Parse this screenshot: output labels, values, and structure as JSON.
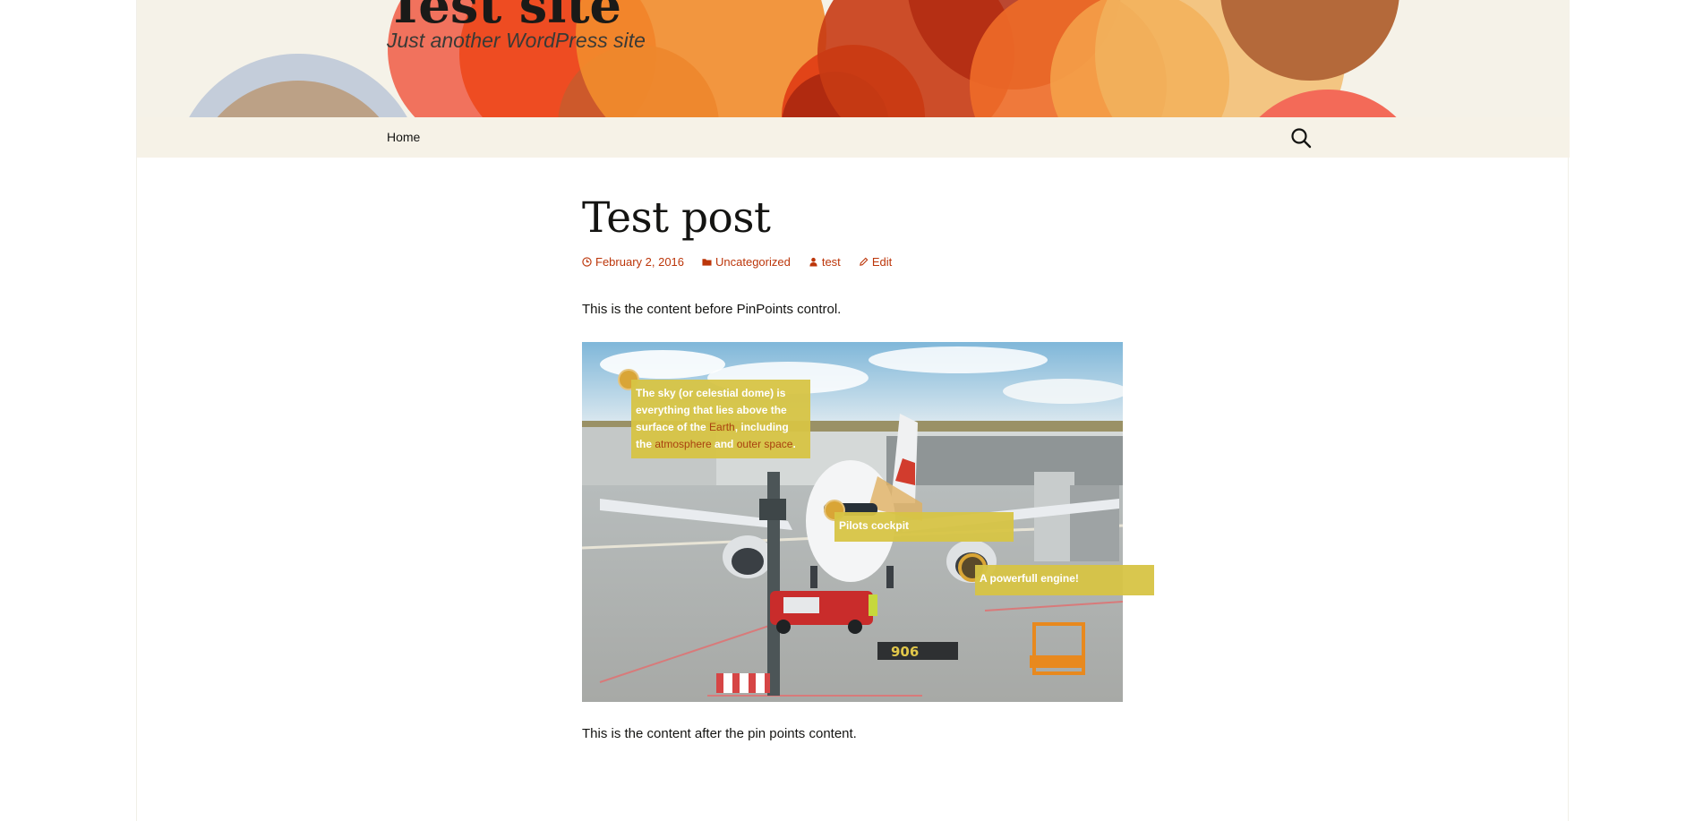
{
  "header": {
    "title": "Test site",
    "description": "Just another WordPress site"
  },
  "nav": {
    "home_label": "Home",
    "search_icon": "search-icon"
  },
  "post": {
    "title": "Test post",
    "meta": {
      "date": "February 2, 2016",
      "category": "Uncategorized",
      "author": "test",
      "edit": "Edit"
    },
    "content_before": "This is the content before PinPoints control.",
    "content_after": "This is the content after the pin points content."
  },
  "pinpoints": {
    "sky": {
      "t1": "The ",
      "t2": "sky",
      "t3": " (or ",
      "t4": "celestial dome",
      "t5": ") is everything that lies above the surface of the ",
      "link_earth": "Earth",
      "t6": ", including the ",
      "link_atmosphere": "atmosphere",
      "t7": " and ",
      "link_outer_space": "outer space",
      "t8": "."
    },
    "cockpit": "Pilots cockpit",
    "engine": "A powerfull engine!"
  },
  "colors": {
    "accent": "#bc360a",
    "header_bg": "#f5f2e8",
    "pin": "#d9a536",
    "tooltip": "#d7c444"
  }
}
